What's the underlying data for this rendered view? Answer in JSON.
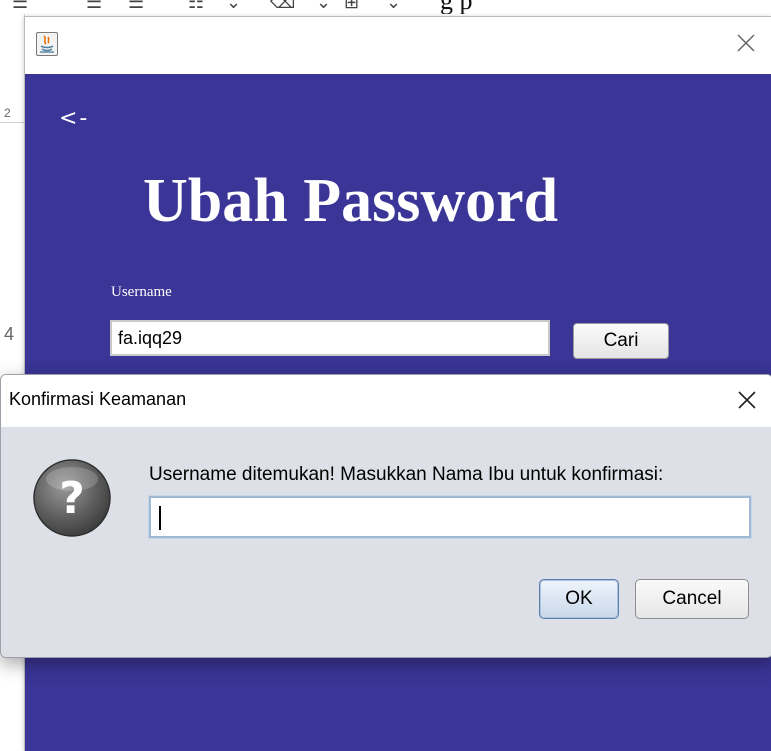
{
  "background": {
    "toolbar_icons": [
      "align-left-icon",
      "align-center-icon",
      "justify-icon",
      "list-icon",
      "chevron-down-icon",
      "eraser-icon",
      "chevron-down-icon",
      "table-icon",
      "chevron-down-icon"
    ],
    "doc_heading_fragment": "g     p",
    "left_markers": [
      "2",
      "4"
    ]
  },
  "main_window": {
    "app_icon": "java-icon",
    "close_icon": "close-icon",
    "back_label": "<-",
    "title": "Ubah Password",
    "username_label": "Username",
    "username_value": "fa.iqq29",
    "search_button": "Cari",
    "colors": {
      "panel_background": "#3a3596",
      "text": "#ffffff"
    }
  },
  "dialog": {
    "title": "Konfirmasi Keamanan",
    "icon": "question-icon",
    "close_icon": "close-icon",
    "message": "Username ditemukan! Masukkan Nama Ibu untuk konfirmasi:",
    "input_value": "",
    "ok_label": "OK",
    "cancel_label": "Cancel",
    "colors": {
      "body_background": "#dde0e6",
      "ok_border": "#5d7fa8"
    }
  }
}
